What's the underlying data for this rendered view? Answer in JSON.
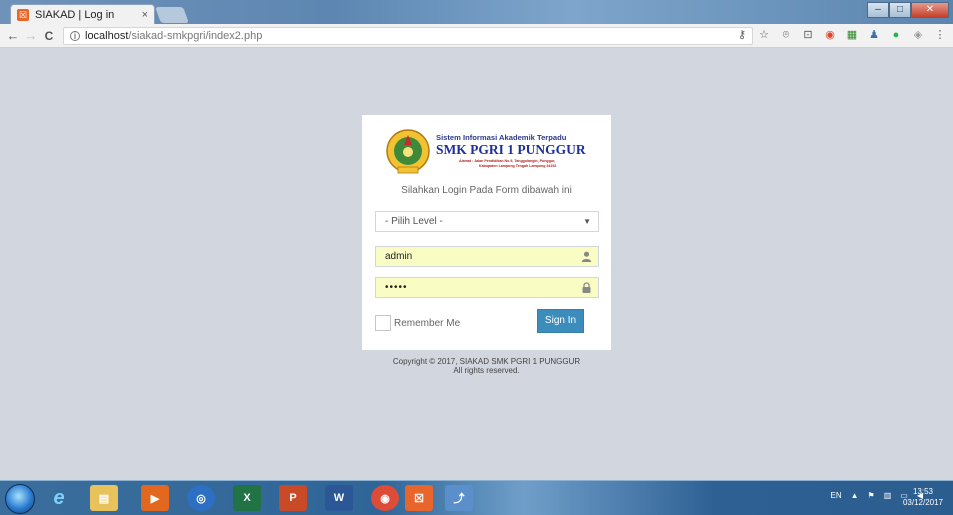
{
  "browser": {
    "tab_title": "SIAKAD | Log in",
    "tab_close": "×",
    "favicon_glyph": "☒",
    "url_host": "localhost",
    "url_path": "/siakad-smkpgri/index2.php",
    "back_glyph": "←",
    "forward_glyph": "→",
    "reload_glyph": "C",
    "info_glyph": "i",
    "minimize_glyph": "–",
    "maximize_glyph": "□",
    "close_glyph": "✕",
    "extensions": [
      "key-icon",
      "star-icon",
      "cast-icon",
      "screenshot-icon",
      "record-icon",
      "monitor-icon",
      "user-icon",
      "chat-icon",
      "puzzle-icon",
      "menu-icon"
    ],
    "extension_glyphs": [
      "⚷",
      "☆",
      "⌾",
      "⊡",
      "◉",
      "▦",
      "♟",
      "●",
      "◈",
      "⋮"
    ]
  },
  "login": {
    "logo_line1": "Sistem Informasi Akademik Terpadu",
    "logo_line2": "SMK PGRI 1 PUNGGUR",
    "logo_line3": "Alamat : Jalan Pendidikan No.9, Tanggulangin, Punggur,",
    "logo_line4": "Kabupaten Lampung Tengah  Lampung 34152",
    "message": "Silahkan Login Pada Form dibawah ini",
    "level_placeholder": "- Pilih Level -",
    "username_value": "admin",
    "password_value": "•••••",
    "remember_label": "Remember Me",
    "signin_label": "Sign In"
  },
  "footer": {
    "copyright_line1": "Copyright © 2017, SIAKAD SMK PGRI 1 PUNGGUR",
    "copyright_line2": "All rights reserved."
  },
  "taskbar": {
    "apps": [
      {
        "name": "internet-explorer-icon",
        "glyph": "e",
        "color": "#1e88e5"
      },
      {
        "name": "file-explorer-icon",
        "glyph": "▤",
        "color": "#e8c25a"
      },
      {
        "name": "media-player-icon",
        "glyph": "▶",
        "color": "#e2681f"
      },
      {
        "name": "teamviewer-icon",
        "glyph": "◎",
        "color": "#2d6fc2"
      },
      {
        "name": "excel-icon",
        "glyph": "X",
        "color": "#217346"
      },
      {
        "name": "powerpoint-icon",
        "glyph": "P",
        "color": "#c94a26"
      },
      {
        "name": "word-icon",
        "glyph": "W",
        "color": "#2b5797"
      },
      {
        "name": "chrome-icon",
        "glyph": "◉",
        "color": "#dd4b39"
      },
      {
        "name": "xampp-icon",
        "glyph": "☒",
        "color": "#e8652b"
      },
      {
        "name": "pinned-app-icon",
        "glyph": "⤴",
        "color": "#5a8fcb"
      }
    ],
    "lang": "EN",
    "time": "13:53",
    "date": "03/12/2017"
  }
}
